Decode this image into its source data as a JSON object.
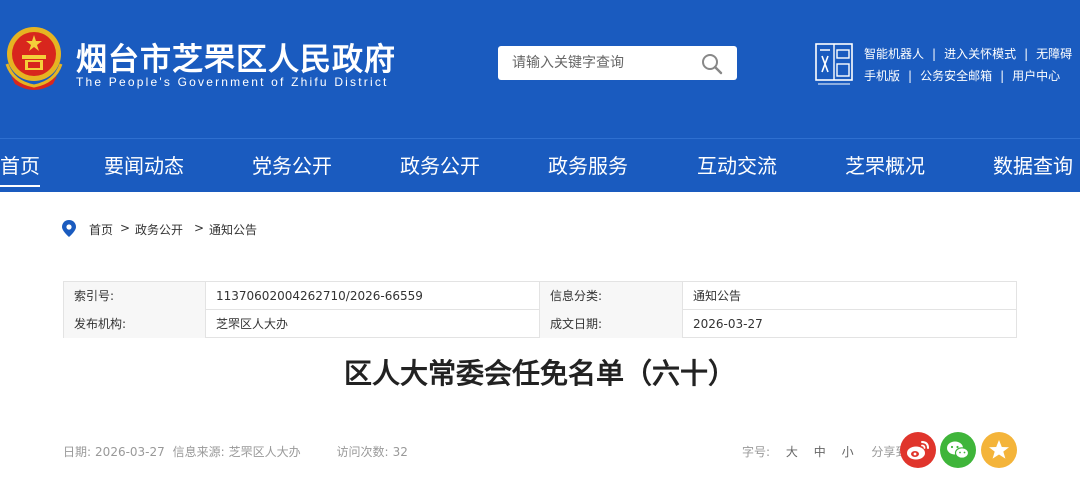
{
  "header": {
    "title": "烟台市芝罘区人民政府",
    "subtitle": "The People's Government of Zhifu District",
    "search_placeholder": "请输入关键字查询",
    "links_row1": [
      "智能机器人",
      "进入关怀模式",
      "无障碍"
    ],
    "links_row2": [
      "手机版",
      "公务安全邮箱",
      "用户中心"
    ]
  },
  "nav": {
    "items": [
      "首页",
      "要闻动态",
      "党务公开",
      "政务公开",
      "政务服务",
      "互动交流",
      "芝罘概况",
      "数据查询"
    ]
  },
  "breadcrumb": {
    "items": [
      "首页",
      "政务公开",
      "通知公告"
    ],
    "separator": ">"
  },
  "info": {
    "index_label": "索引号:",
    "index_value": "11370602004262710/2026-66559",
    "category_label": "信息分类:",
    "category_value": "通知公告",
    "publisher_label": "发布机构:",
    "publisher_value": "芝罘区人大办",
    "date_label": "成文日期:",
    "date_value": "2026-03-27"
  },
  "article": {
    "title": "区人大常委会任免名单（六十）"
  },
  "meta": {
    "date_label": "日期:",
    "date_value": "2026-03-27",
    "source_label": "信息来源:",
    "source_value": "芝罘区人大办",
    "visits_label": "访问次数:",
    "visits_value": "32"
  },
  "tools": {
    "font_label": "字号:",
    "font_large": "大",
    "font_medium": "中",
    "font_small": "小",
    "share_label": "分享到:"
  },
  "colors": {
    "brand_blue": "#1a5bbf",
    "weibo_red": "#e0352c",
    "wechat_green": "#3fb53a",
    "favorite_yellow": "#f4b43a"
  }
}
